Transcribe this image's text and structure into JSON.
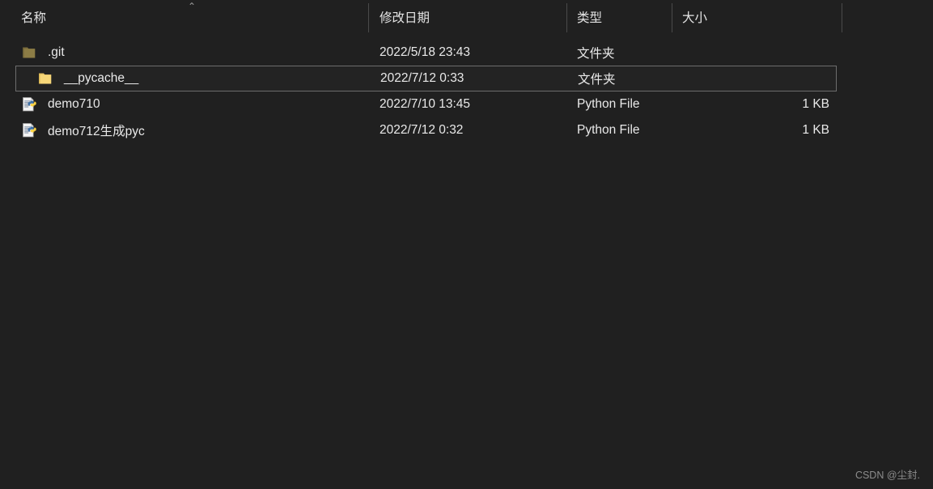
{
  "header": {
    "sort_caret": "⌃",
    "columns": [
      {
        "label": "名称",
        "name": "column-header-name"
      },
      {
        "label": "修改日期",
        "name": "column-header-date-modified"
      },
      {
        "label": "类型",
        "name": "column-header-type"
      },
      {
        "label": "大小",
        "name": "column-header-size"
      }
    ]
  },
  "files": [
    {
      "name": ".git",
      "date_modified": "2022/5/18 23:43",
      "type": "文件夹",
      "size": "",
      "icon": "folder-icon-hidden",
      "selected": false
    },
    {
      "name": "__pycache__",
      "date_modified": "2022/7/12 0:33",
      "type": "文件夹",
      "size": "",
      "icon": "folder-icon",
      "selected": true
    },
    {
      "name": "demo710",
      "date_modified": "2022/7/10 13:45",
      "type": "Python File",
      "size": "1 KB",
      "icon": "python-file-icon",
      "selected": false
    },
    {
      "name": "demo712生成pyc",
      "date_modified": "2022/7/12 0:32",
      "type": "Python File",
      "size": "1 KB",
      "icon": "python-file-icon",
      "selected": false
    }
  ],
  "watermark": {
    "text": "CSDN @尘封."
  },
  "colors": {
    "background": "#202020",
    "text": "#e9e9e9",
    "separator": "#4a4a4a",
    "selection_border": "#6d6d6d",
    "selection_fill": "#232323",
    "folder": "#f7d779",
    "folder_hidden": "#8c7c45",
    "python_blue": "#3b6ea5",
    "python_yellow": "#ffd343",
    "watermark": "#8d8d8d"
  }
}
